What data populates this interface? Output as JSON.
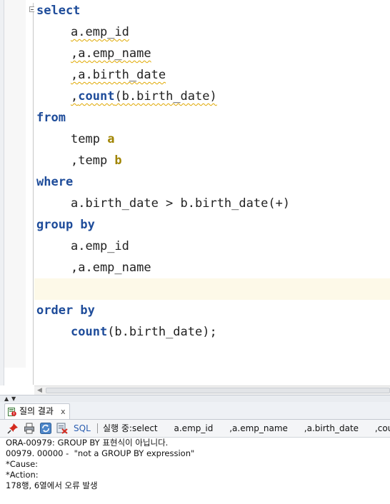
{
  "editor": {
    "lines": [
      {
        "indent": false,
        "parts": [
          {
            "text": "select",
            "style": "kw"
          }
        ]
      },
      {
        "indent": true,
        "parts": [
          {
            "text": "a.emp_id",
            "style": "squig"
          }
        ]
      },
      {
        "indent": true,
        "parts": [
          {
            "text": ",a.emp_name",
            "style": "squig"
          }
        ]
      },
      {
        "indent": true,
        "parts": [
          {
            "text": ",a.birth_date",
            "style": "squig"
          }
        ]
      },
      {
        "indent": true,
        "parts": [
          {
            "text": ",",
            "style": "squig"
          },
          {
            "text": "count",
            "style": "fn squig"
          },
          {
            "text": "(b.birth_date)",
            "style": "squig"
          }
        ]
      },
      {
        "indent": false,
        "parts": [
          {
            "text": "from",
            "style": "kw"
          }
        ]
      },
      {
        "indent": true,
        "parts": [
          {
            "text": "temp ",
            "style": ""
          },
          {
            "text": "a",
            "style": "alias"
          }
        ]
      },
      {
        "indent": true,
        "parts": [
          {
            "text": ",temp ",
            "style": ""
          },
          {
            "text": "b",
            "style": "alias"
          }
        ]
      },
      {
        "indent": false,
        "parts": [
          {
            "text": "where",
            "style": "kw"
          }
        ]
      },
      {
        "indent": true,
        "parts": [
          {
            "text": "a.birth_date > b.birth_date(+)",
            "style": ""
          }
        ]
      },
      {
        "indent": false,
        "parts": [
          {
            "text": "group by",
            "style": "kw"
          }
        ]
      },
      {
        "indent": true,
        "parts": [
          {
            "text": "a.emp_id",
            "style": ""
          }
        ]
      },
      {
        "indent": true,
        "parts": [
          {
            "text": ",a.emp_name",
            "style": ""
          }
        ]
      },
      {
        "indent": false,
        "current": true,
        "parts": [
          {
            "text": "",
            "style": ""
          }
        ]
      },
      {
        "indent": false,
        "parts": [
          {
            "text": "order by",
            "style": "kw"
          }
        ]
      },
      {
        "indent": true,
        "parts": [
          {
            "text": "count",
            "style": "fn"
          },
          {
            "text": "(b.birth_date);",
            "style": ""
          }
        ]
      }
    ]
  },
  "result_panel": {
    "tab_label": "질의 결과",
    "tab_close": "x",
    "tab_icon": "error-result-icon",
    "toolbar": {
      "icons": [
        "pin-icon",
        "print-icon",
        "refresh-icon",
        "clear-icon"
      ],
      "sql_label": "SQL",
      "status_text": "실행 중:select      a.emp_id      ,a.emp_name      ,a.birth_date      ,count(b.birth_date)"
    },
    "output_lines": [
      "ORA-00979: GROUP BY 표현식이 아닙니다.",
      "00979. 00000 -  \"not a GROUP BY expression\"",
      "*Cause:",
      "*Action:",
      "178행, 6열에서 오류 발생"
    ]
  },
  "colors": {
    "keyword": "#1e4c9a",
    "alias": "#a08400",
    "squiggle": "#e0a800",
    "current_line": "#fdf9e8"
  }
}
